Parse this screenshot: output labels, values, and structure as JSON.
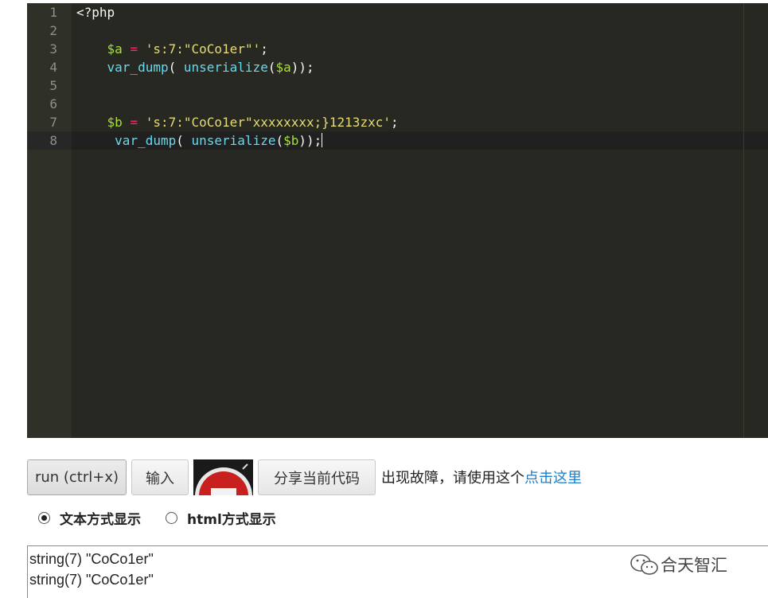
{
  "editor": {
    "lines": [
      {
        "num": "1",
        "tokens": [
          {
            "t": "<?php",
            "c": "t-pl"
          }
        ]
      },
      {
        "num": "2",
        "tokens": []
      },
      {
        "num": "3",
        "tokens": [
          {
            "t": "    ",
            "c": "t-pl"
          },
          {
            "t": "$a",
            "c": "t-var"
          },
          {
            "t": " ",
            "c": "t-pl"
          },
          {
            "t": "=",
            "c": "t-op"
          },
          {
            "t": " ",
            "c": "t-pl"
          },
          {
            "t": "'s:7:\"CoCo1er\"'",
            "c": "t-str"
          },
          {
            "t": ";",
            "c": "t-pl"
          }
        ]
      },
      {
        "num": "4",
        "tokens": [
          {
            "t": "    ",
            "c": "t-pl"
          },
          {
            "t": "var_dump",
            "c": "t-fn"
          },
          {
            "t": "( ",
            "c": "t-pl"
          },
          {
            "t": "unserialize",
            "c": "t-fn"
          },
          {
            "t": "(",
            "c": "t-pl"
          },
          {
            "t": "$a",
            "c": "t-var"
          },
          {
            "t": "));",
            "c": "t-pl"
          }
        ]
      },
      {
        "num": "5",
        "tokens": []
      },
      {
        "num": "6",
        "tokens": []
      },
      {
        "num": "7",
        "tokens": [
          {
            "t": "    ",
            "c": "t-pl"
          },
          {
            "t": "$b",
            "c": "t-var"
          },
          {
            "t": " ",
            "c": "t-pl"
          },
          {
            "t": "=",
            "c": "t-op"
          },
          {
            "t": " ",
            "c": "t-pl"
          },
          {
            "t": "'s:7:\"CoCo1er\"xxxxxxxx;}1213zxc'",
            "c": "t-str"
          },
          {
            "t": ";",
            "c": "t-pl"
          }
        ]
      },
      {
        "num": "8",
        "tokens": [
          {
            "t": "     ",
            "c": "t-pl"
          },
          {
            "t": "var_dump",
            "c": "t-fn"
          },
          {
            "t": "( ",
            "c": "t-pl"
          },
          {
            "t": "unserialize",
            "c": "t-fn"
          },
          {
            "t": "(",
            "c": "t-pl"
          },
          {
            "t": "$b",
            "c": "t-var"
          },
          {
            "t": "));",
            "c": "t-pl"
          }
        ]
      }
    ],
    "active_line": "8"
  },
  "toolbar": {
    "run_label": "run (ctrl+x)",
    "input_label": "输入",
    "share_label": "分享当前代码",
    "notice_text": "出现故障，请使用这个",
    "notice_link": "点击这里",
    "stop_icon": "stop-sign-icon"
  },
  "display_mode": {
    "text_label": "文本方式显示",
    "html_label": "html方式显示",
    "selected": "text"
  },
  "output": {
    "lines": [
      "string(7) \"CoCo1er\"",
      "string(7) \"CoCo1er\""
    ]
  },
  "watermark": {
    "icon": "wechat-icon",
    "text": "合天智汇"
  }
}
